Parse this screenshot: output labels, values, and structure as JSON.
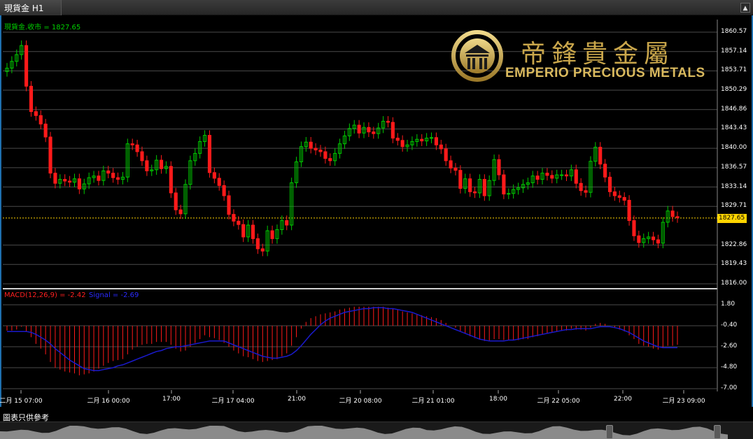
{
  "tab": {
    "title": "現貨金 H1",
    "scroll_glyph": "▲"
  },
  "legend": {
    "main": "現貨金.收市 = 1827.65",
    "macd": "MACD(12,26,9) = -2.42",
    "signal": "Signal = -2.69"
  },
  "logo": {
    "chinese": "帝鋒貴金屬",
    "english": "EMPERIO PRECIOUS METALS"
  },
  "price_axis": [
    "1860.57",
    "1857.14",
    "1853.71",
    "1850.29",
    "1846.86",
    "1843.43",
    "1840.00",
    "1836.57",
    "1833.14",
    "1829.71",
    "1827.65",
    "1822.86",
    "1819.43",
    "1816.00"
  ],
  "current_price": "1827.65",
  "macd_axis": [
    "1.80",
    "-0.40",
    "-2.60",
    "-4.80",
    "-7.00"
  ],
  "time_axis": [
    "二月 15 07:00",
    "二月 16 00:00",
    "17:00",
    "二月 17 04:00",
    "21:00",
    "二月 20 08:00",
    "二月 21 01:00",
    "18:00",
    "二月 22 05:00",
    "22:00",
    "二月 23 09:00"
  ],
  "footer": {
    "disclaimer": "圖表只供參考"
  },
  "colors": {
    "up": "#00c800",
    "down": "#ff1a1a",
    "signal": "#1a1acc",
    "grid": "#4a4a4a",
    "current": "#ffd400",
    "accent": "#1e6fae"
  },
  "chart_data": [
    {
      "type": "candlestick",
      "title": "現貨金 H1",
      "series_label": "現貨金.收市",
      "last": 1827.65,
      "ylim": [
        1816.0,
        1860.57
      ],
      "x_ticks": [
        "二月 15 07:00",
        "二月 16 00:00",
        "17:00",
        "二月 17 04:00",
        "21:00",
        "二月 20 08:00",
        "二月 21 01:00",
        "18:00",
        "二月 22 05:00",
        "22:00",
        "二月 23 09:00"
      ],
      "close": [
        1854.2,
        1855.4,
        1856.6,
        1858.2,
        1851.0,
        1846.5,
        1845.8,
        1844.3,
        1842.0,
        1835.6,
        1833.8,
        1834.5,
        1834.2,
        1834.0,
        1834.6,
        1832.8,
        1833.7,
        1834.8,
        1835.1,
        1834.3,
        1836.0,
        1835.6,
        1834.8,
        1834.5,
        1834.9,
        1840.8,
        1840.6,
        1839.4,
        1837.8,
        1836.0,
        1836.2,
        1837.9,
        1836.4,
        1836.8,
        1832.1,
        1829.1,
        1828.4,
        1833.6,
        1837.8,
        1839.1,
        1841.2,
        1842.3,
        1835.7,
        1834.7,
        1833.4,
        1831.6,
        1828.3,
        1827.1,
        1826.5,
        1824.3,
        1826.4,
        1824.0,
        1822.2,
        1821.8,
        1825.4,
        1824.0,
        1825.6,
        1827.2,
        1826.4,
        1833.9,
        1837.6,
        1840.3,
        1841.1,
        1840.0,
        1839.7,
        1839.4,
        1838.2,
        1837.8,
        1839.1,
        1840.8,
        1842.2,
        1843.5,
        1844.1,
        1842.7,
        1843.7,
        1842.9,
        1842.6,
        1843.6,
        1844.8,
        1844.6,
        1841.8,
        1841.4,
        1840.3,
        1840.6,
        1841.2,
        1841.6,
        1841.3,
        1841.8,
        1841.9,
        1840.6,
        1839.9,
        1837.8,
        1836.5,
        1836.1,
        1832.9,
        1834.6,
        1832.3,
        1832.1,
        1834.5,
        1831.6,
        1834.3,
        1838.0,
        1835.3,
        1831.9,
        1832.0,
        1832.7,
        1833.0,
        1833.6,
        1833.9,
        1835.1,
        1834.5,
        1835.6,
        1835.2,
        1834.7,
        1835.3,
        1835.3,
        1835.1,
        1836.2,
        1833.8,
        1832.5,
        1832.2,
        1837.7,
        1840.2,
        1837.2,
        1834.9,
        1832.3,
        1831.6,
        1831.3,
        1830.8,
        1827.2,
        1824.5,
        1823.3,
        1824.0,
        1824.3,
        1823.8,
        1823.2,
        1826.9,
        1828.9,
        1827.9,
        1827.7
      ],
      "ylim_note": "price axis",
      "lower_panel": {
        "type": "bar+line",
        "name": "MACD(12,26,9)",
        "last_macd": -2.42,
        "signal_name": "Signal",
        "last_signal": -2.69,
        "ylim": [
          -7.0,
          1.8
        ],
        "macd_hist": [
          -0.9,
          -0.9,
          -0.8,
          -0.5,
          -1.0,
          -1.6,
          -2.3,
          -2.8,
          -3.4,
          -4.2,
          -4.8,
          -5.0,
          -5.2,
          -5.3,
          -5.4,
          -5.6,
          -5.5,
          -5.4,
          -5.2,
          -4.9,
          -4.6,
          -4.3,
          -4.1,
          -4.0,
          -3.9,
          -3.4,
          -2.9,
          -2.6,
          -2.4,
          -2.3,
          -2.3,
          -2.1,
          -2.1,
          -2.1,
          -2.4,
          -2.8,
          -3.1,
          -3.0,
          -2.6,
          -2.2,
          -1.8,
          -1.4,
          -1.6,
          -1.7,
          -1.9,
          -2.2,
          -2.6,
          -3.0,
          -3.3,
          -3.6,
          -3.7,
          -3.9,
          -4.1,
          -4.2,
          -4.1,
          -4.0,
          -3.9,
          -3.6,
          -3.3,
          -2.5,
          -1.6,
          -0.7,
          0.0,
          0.4,
          0.6,
          0.8,
          0.9,
          1.0,
          1.1,
          1.3,
          1.4,
          1.5,
          1.6,
          1.6,
          1.6,
          1.6,
          1.6,
          1.6,
          1.6,
          1.5,
          1.4,
          1.3,
          1.1,
          1.0,
          0.9,
          0.8,
          0.7,
          0.6,
          0.5,
          0.4,
          0.2,
          -0.1,
          -0.4,
          -0.6,
          -1.0,
          -1.2,
          -1.5,
          -1.7,
          -1.8,
          -2.0,
          -2.0,
          -1.8,
          -1.8,
          -1.9,
          -1.9,
          -1.9,
          -1.9,
          -1.8,
          -1.8,
          -1.6,
          -1.5,
          -1.3,
          -1.2,
          -1.1,
          -1.0,
          -0.9,
          -0.9,
          -0.7,
          -0.8,
          -0.8,
          -0.9,
          -0.6,
          -0.2,
          -0.1,
          -0.2,
          -0.4,
          -0.6,
          -0.8,
          -1.0,
          -1.4,
          -1.8,
          -2.3,
          -2.5,
          -2.6,
          -2.8,
          -2.9,
          -2.7,
          -2.5,
          -2.5,
          -2.4
        ],
        "signal": [
          -1.0,
          -1.0,
          -1.0,
          -1.0,
          -1.0,
          -1.1,
          -1.3,
          -1.6,
          -1.9,
          -2.3,
          -2.8,
          -3.2,
          -3.6,
          -4.0,
          -4.3,
          -4.6,
          -4.9,
          -5.0,
          -5.1,
          -5.1,
          -5.0,
          -4.9,
          -4.8,
          -4.6,
          -4.5,
          -4.3,
          -4.1,
          -3.9,
          -3.7,
          -3.5,
          -3.3,
          -3.1,
          -3.0,
          -2.8,
          -2.7,
          -2.6,
          -2.6,
          -2.5,
          -2.4,
          -2.3,
          -2.2,
          -2.1,
          -2.0,
          -2.0,
          -2.0,
          -2.0,
          -2.2,
          -2.4,
          -2.6,
          -2.8,
          -3.0,
          -3.2,
          -3.4,
          -3.6,
          -3.7,
          -3.8,
          -3.8,
          -3.7,
          -3.6,
          -3.4,
          -3.0,
          -2.5,
          -1.9,
          -1.3,
          -0.8,
          -0.3,
          0.1,
          0.4,
          0.6,
          0.8,
          1.0,
          1.1,
          1.2,
          1.3,
          1.4,
          1.4,
          1.5,
          1.5,
          1.5,
          1.4,
          1.4,
          1.3,
          1.2,
          1.1,
          1.0,
          0.8,
          0.6,
          0.4,
          0.2,
          0.0,
          -0.2,
          -0.4,
          -0.6,
          -0.8,
          -1.0,
          -1.2,
          -1.4,
          -1.6,
          -1.8,
          -1.9,
          -2.0,
          -2.0,
          -2.0,
          -2.0,
          -1.9,
          -1.9,
          -1.8,
          -1.7,
          -1.6,
          -1.5,
          -1.4,
          -1.3,
          -1.2,
          -1.1,
          -1.0,
          -0.9,
          -0.8,
          -0.8,
          -0.7,
          -0.7,
          -0.7,
          -0.7,
          -0.6,
          -0.5,
          -0.5,
          -0.5,
          -0.6,
          -0.7,
          -0.9,
          -1.1,
          -1.4,
          -1.7,
          -2.0,
          -2.2,
          -2.4,
          -2.6,
          -2.7,
          -2.7,
          -2.7,
          -2.7
        ]
      }
    }
  ]
}
